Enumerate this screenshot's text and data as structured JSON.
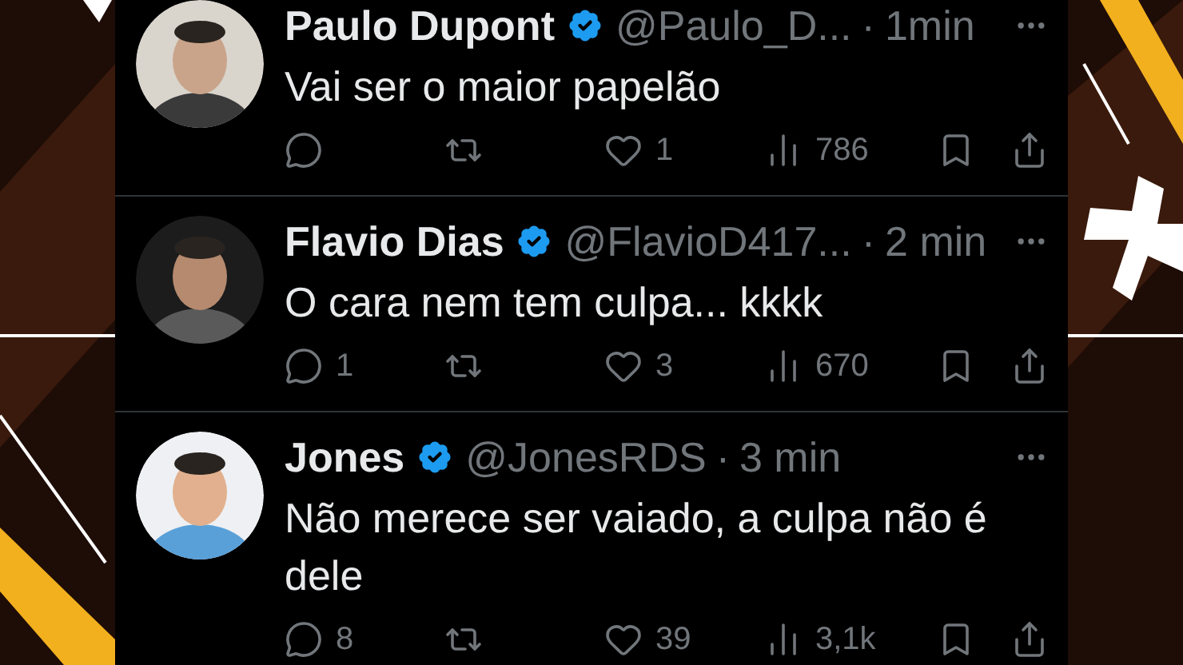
{
  "tweets": [
    {
      "name": "Paulo Dupont",
      "verified": true,
      "handle": "@Paulo_D...",
      "separator": "·",
      "time": "1min",
      "text": "Vai ser o maior papelão",
      "likes": "1",
      "views": "786"
    },
    {
      "name": "Flavio Dias",
      "verified": true,
      "handle": "@FlavioD417...",
      "separator": "·",
      "time": "2 min",
      "text": "O cara nem tem culpa... kkkk",
      "replies": "1",
      "likes": "3",
      "views": "670"
    },
    {
      "name": "Jones",
      "verified": true,
      "handle": "@JonesRDS",
      "separator": "·",
      "time": "3 min",
      "text": "Não merece ser vaiado, a culpa não é dele",
      "replies": "8",
      "likes": "39",
      "views": "3,1k"
    }
  ]
}
